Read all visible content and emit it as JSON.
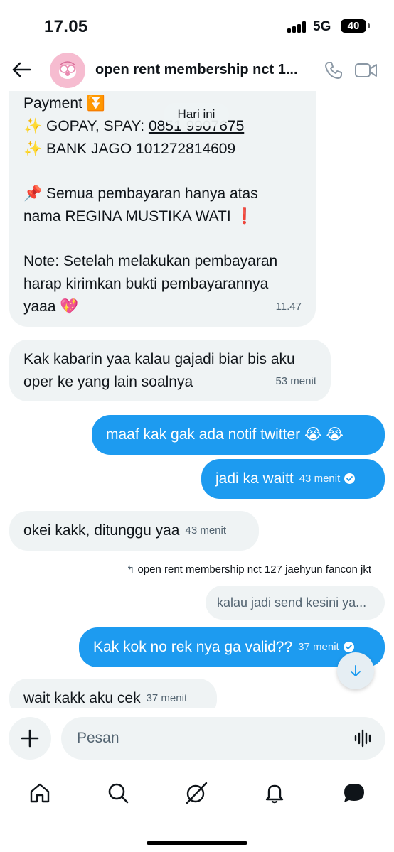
{
  "status_bar": {
    "time": "17.05",
    "network": "5G",
    "battery": "40"
  },
  "header": {
    "title": "open rent membership nct 127 jaehyun fancon jkt",
    "title_display": "open rent membership nct 1..."
  },
  "date_separator": "Hari ini",
  "messages": {
    "payment": {
      "lines": [
        "Payment ⏬",
        "✨ GOPAY, SPAY: 0851 9907675",
        "✨ BANK JAGO 101272814609",
        "",
        "📌 Semua pembayaran hanya atas",
        "nama REGINA MUSTIKA WATI ❗",
        "",
        "Note: Setelah melakukan pembayaran",
        "harap kirimkan bukti pembayarannya",
        "yaaa 💖"
      ],
      "gopay_label": "✨ GOPAY, SPAY: ",
      "gopay_number": "0851 9907675",
      "time": "11.47"
    },
    "kabarin": {
      "line1": "Kak kabarin yaa kalau gajadi biar bis aku",
      "line2": "oper ke yang lain soalnya",
      "time": "53 menit"
    },
    "maaf": {
      "text": "maaf kak gak ada notif twitter 😭 😭"
    },
    "jadi": {
      "text": "jadi ka waitt",
      "time": "43 menit"
    },
    "okei": {
      "text": "okei kakk, ditunggu yaa",
      "time": "43 menit"
    },
    "reply": {
      "label": "open rent membership nct 127 jaehyun fancon jkt",
      "quote": "kalau jadi send kesini ya..."
    },
    "kak_kok": {
      "text": "Kak kok no rek nya ga valid??",
      "time": "37 menit"
    },
    "wait": {
      "text": "wait kakk aku cek",
      "time": "37 menit"
    }
  },
  "composer": {
    "placeholder": "Pesan"
  },
  "nav": {
    "items": [
      {
        "name": "home",
        "icon": "home-icon"
      },
      {
        "name": "search",
        "icon": "search-icon"
      },
      {
        "name": "grok",
        "icon": "grok-icon"
      },
      {
        "name": "notifications",
        "icon": "bell-icon"
      },
      {
        "name": "messages",
        "icon": "messages-icon"
      }
    ]
  },
  "colors": {
    "accent": "#1d9bf0",
    "incoming_bubble": "#eff3f4",
    "text": "#0f1419",
    "muted": "#536471"
  }
}
